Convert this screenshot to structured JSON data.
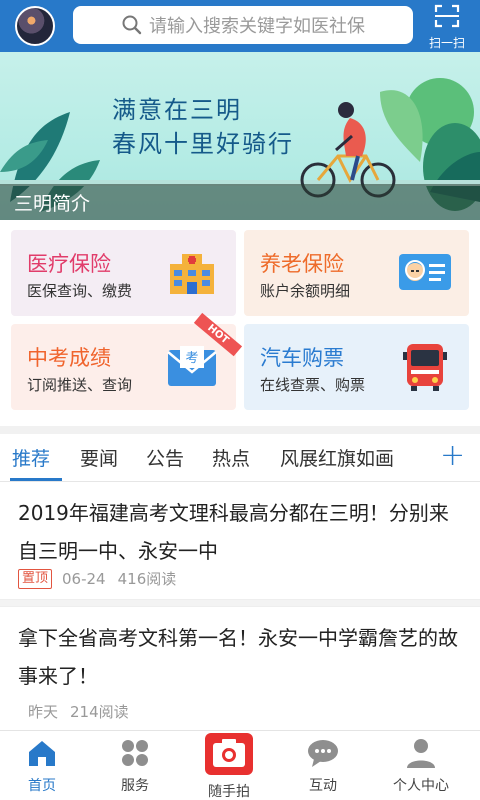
{
  "header": {
    "search_placeholder": "请输入搜索关键字如医社保",
    "scan_label": "扫一扫"
  },
  "banner": {
    "line1": "满意在三明",
    "line2": "春风十里好骑行",
    "caption": "三明简介"
  },
  "services": [
    {
      "title": "医疗保险",
      "subtitle": "医保查询、缴费",
      "icon": "hospital-icon"
    },
    {
      "title": "养老保险",
      "subtitle": "账户余额明细",
      "icon": "id-card-icon"
    },
    {
      "title": "中考成绩",
      "subtitle": "订阅推送、查询",
      "icon": "exam-envelope-icon",
      "badge": "HOT"
    },
    {
      "title": "汽车购票",
      "subtitle": "在线查票、购票",
      "icon": "bus-icon"
    }
  ],
  "tabs": {
    "items": [
      "推荐",
      "要闻",
      "公告",
      "热点",
      "风展红旗如画"
    ],
    "active_index": 0,
    "add_label": "+"
  },
  "news": [
    {
      "title": "2019年福建高考文理科最高分都在三明！分别来自三明一中、永安一中",
      "tag": "置顶",
      "date": "06-24",
      "reads": "416阅读"
    },
    {
      "title": "拿下全省高考文科第一名！永安一中学霸詹艺的故事来了！",
      "date": "昨天",
      "reads": "214阅读"
    }
  ],
  "bottom_nav": {
    "items": [
      "首页",
      "服务",
      "随手拍",
      "互动",
      "个人中心"
    ],
    "active_index": 0
  },
  "colors": {
    "primary": "#2879c9",
    "camera_red": "#e8302f",
    "pin_red": "#e25540"
  }
}
